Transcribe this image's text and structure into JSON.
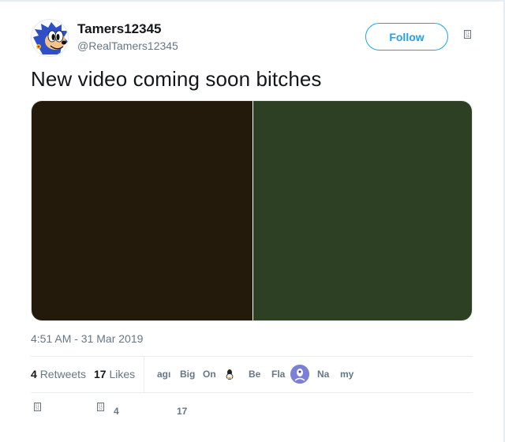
{
  "tweet": {
    "display_name": "Tamers12345",
    "handle": "@RealTamers12345",
    "follow_label": "Follow",
    "caret_glyph": "F1 56",
    "text": "New video coming soon bitches",
    "media": {
      "left_color": "#241a0c",
      "right_color": "#2e4023"
    },
    "timestamp": "4:51 AM - 31 Mar 2019"
  },
  "stats": {
    "retweets_count": "4",
    "retweets_label": "Retweets",
    "likes_count": "17",
    "likes_label": "Likes"
  },
  "likers": [
    "agı",
    "Big",
    "On",
    "Be",
    "Fla",
    "Na",
    "my"
  ],
  "actions": {
    "reply_glyph": "F1 51",
    "retweet_glyph": "F1 52",
    "retweet_count": "4",
    "like_count": "17"
  },
  "colors": {
    "accent": "#1da1f2",
    "secondary_text": "#657786",
    "primary_text": "#14171a"
  }
}
